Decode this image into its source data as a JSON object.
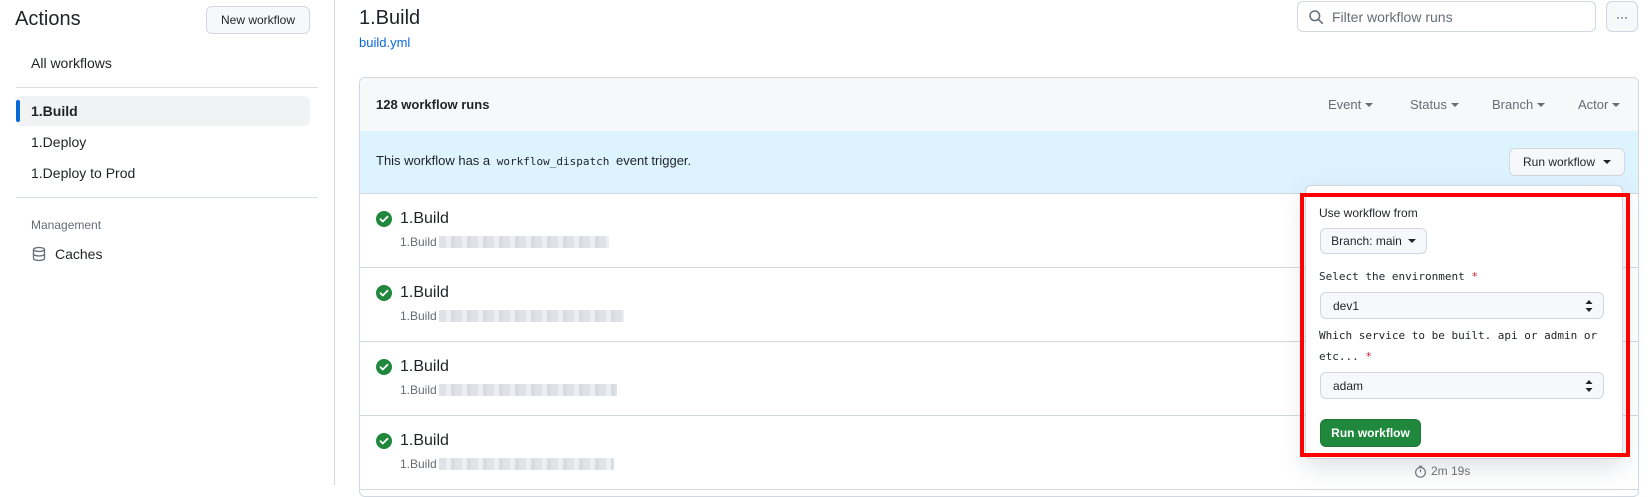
{
  "sidebar": {
    "title": "Actions",
    "new_workflow_label": "New workflow",
    "all_workflows_label": "All workflows",
    "workflows": [
      {
        "label": "1.Build",
        "active": true
      },
      {
        "label": "1.Deploy",
        "active": false
      },
      {
        "label": "1.Deploy to Prod",
        "active": false
      }
    ],
    "management_heading": "Management",
    "caches_label": "Caches"
  },
  "header": {
    "title": "1.Build",
    "file_link": "build.yml",
    "filter_placeholder": "Filter workflow runs",
    "more_label": "···"
  },
  "runs": {
    "count_label": "128 workflow runs",
    "filters": [
      "Event",
      "Status",
      "Branch",
      "Actor"
    ],
    "dispatch_text_before": "This workflow has a",
    "dispatch_code": "workflow_dispatch",
    "dispatch_text_after": "event trigger.",
    "run_workflow_label": "Run workflow",
    "items": [
      {
        "name": "1.Build",
        "sub": "1.Build"
      },
      {
        "name": "1.Build",
        "sub": "1.Build"
      },
      {
        "name": "1.Build",
        "sub": "1.Build"
      },
      {
        "name": "1.Build",
        "sub": "1.Build",
        "duration": "2m 19s"
      }
    ]
  },
  "dialog": {
    "use_from_label": "Use workflow from",
    "branch_label": "Branch: main",
    "env_label": "Select the environment",
    "env_value": "dev1",
    "service_label": "Which service to be built. api or admin or etc...",
    "service_value": "adam",
    "required_mark": "*",
    "submit_label": "Run workflow"
  },
  "colors": {
    "accent": "#0969da",
    "success": "#1f883d",
    "dispatch_bg": "#ddf4ff",
    "highlight": "#ff0000"
  }
}
